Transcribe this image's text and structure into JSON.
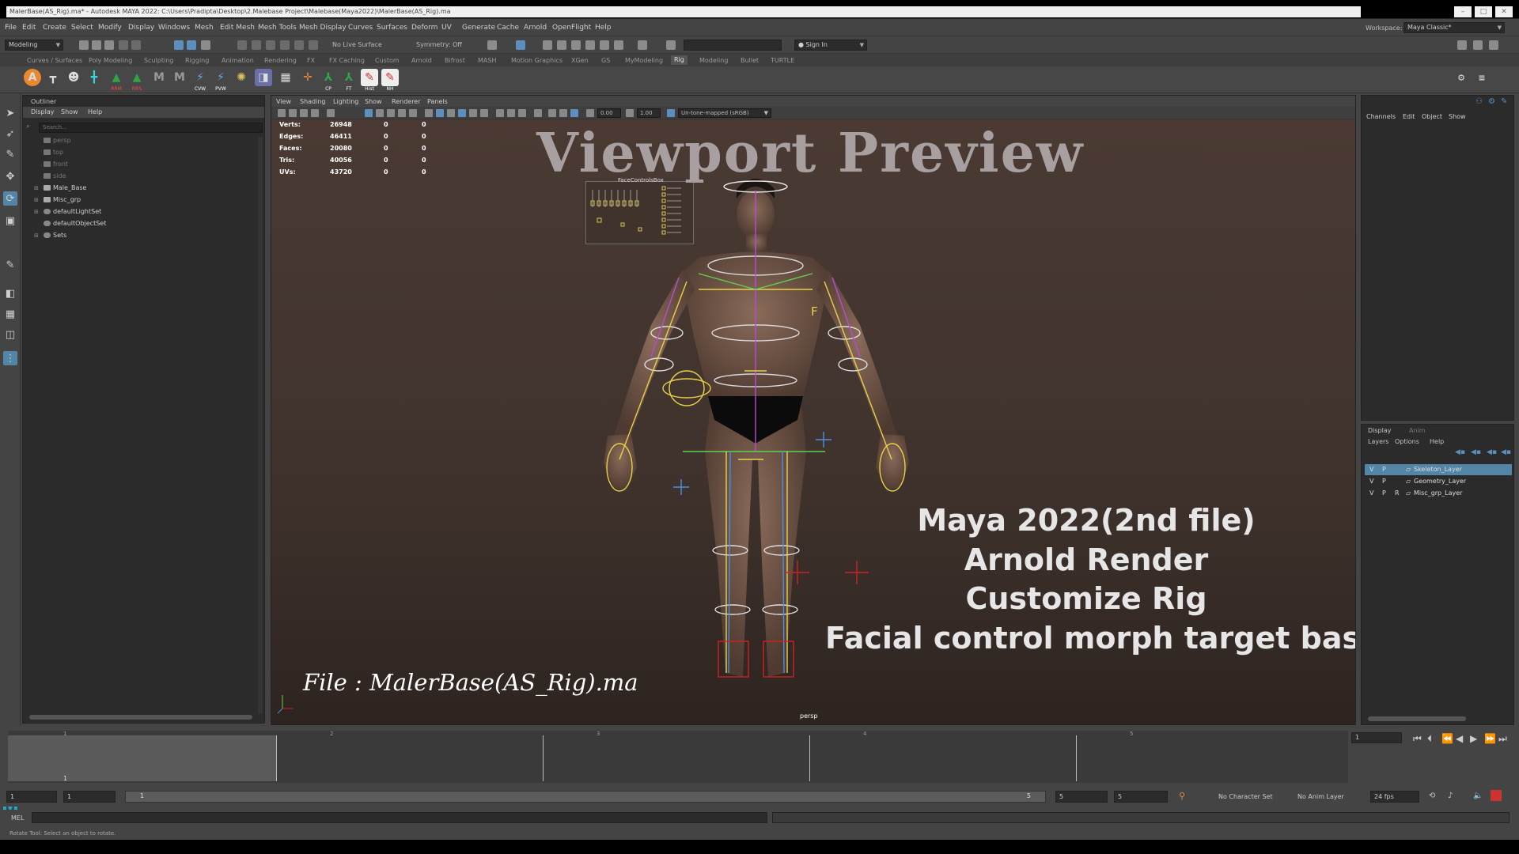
{
  "window": {
    "title": "MalerBase(AS_Rig).ma* - Autodesk MAYA 2022: C:\\Users\\Pradipta\\Desktop\\2.Malebase Project\\Malebase(Maya2022)\\MalerBase(AS_Rig).ma",
    "min": "–",
    "max": "□",
    "close": "✕"
  },
  "menubar": {
    "items": [
      "File",
      "Edit",
      "Create",
      "Select",
      "Modify",
      "Display",
      "Windows",
      "Mesh",
      "Edit Mesh",
      "Mesh Tools",
      "Mesh Display",
      "Curves",
      "Surfaces",
      "Deform",
      "UV",
      "Generate",
      "Cache",
      "Arnold",
      "OpenFlight",
      "Help"
    ],
    "workspace_label": "Workspace:",
    "workspace_value": "Maya Classic*"
  },
  "statusline": {
    "mode": "Modeling",
    "live_surface": "No Live Surface",
    "symmetry": "Symmetry: Off",
    "sign_in": "Sign In"
  },
  "shelf": {
    "tabs": [
      "Curves / Surfaces",
      "Poly Modeling",
      "Sculpting",
      "Rigging",
      "Animation",
      "Rendering",
      "FX",
      "FX Caching",
      "Custom",
      "Arnold",
      "Bifrost",
      "MASH",
      "Motion Graphics",
      "XGen",
      "GS",
      "MyModeling",
      "Rig",
      "Modeling",
      "Bullet",
      "TURTLE"
    ],
    "active_tab": "Rig",
    "icon_labels": [
      "RRM",
      "RRS",
      "CVW",
      "PVW",
      "CP",
      "FT",
      "Hist",
      "NH"
    ]
  },
  "outliner": {
    "tab": "Outliner",
    "menu": [
      "Display",
      "Show",
      "Help"
    ],
    "search_placeholder": "Search...",
    "items": [
      "persp",
      "top",
      "front",
      "side",
      "Male_Base",
      "Misc_grp",
      "defaultLightSet",
      "defaultObjectSet",
      "Sets"
    ]
  },
  "viewport": {
    "menu": [
      "View",
      "Shading",
      "Lighting",
      "Show",
      "Renderer",
      "Panels"
    ],
    "field_a": "0.00",
    "field_b": "1.00",
    "colorspace": "Un-tone-mapped (sRGB)",
    "hud": [
      {
        "label": "Verts:",
        "a": "26948",
        "b": "0",
        "c": "0"
      },
      {
        "label": "Edges:",
        "a": "46411",
        "b": "0",
        "c": "0"
      },
      {
        "label": "Faces:",
        "a": "20080",
        "b": "0",
        "c": "0"
      },
      {
        "label": "Tris:",
        "a": "40056",
        "b": "0",
        "c": "0"
      },
      {
        "label": "UVs:",
        "a": "43720",
        "b": "0",
        "c": "0"
      }
    ],
    "title": "Viewport Preview",
    "overlay_lines": [
      "Maya 2022(2nd file)",
      "Arnold Render",
      "Customize Rig",
      "Facial control morph target base"
    ],
    "file_caption": "File : MalerBase(AS_Rig).ma",
    "camera": "persp",
    "face_control_label": "FaceControlsBox",
    "face_marker": "F"
  },
  "channelbox": {
    "menu": [
      "Channels",
      "Edit",
      "Object",
      "Show"
    ]
  },
  "layers": {
    "tabs": [
      "Display",
      "Anim"
    ],
    "menu": [
      "Layers",
      "Options",
      "Help"
    ],
    "rows": [
      {
        "v": "V",
        "p": "P",
        "r": "",
        "name": "Skeleton_Layer",
        "selected": true
      },
      {
        "v": "V",
        "p": "P",
        "r": "",
        "name": "Geometry_Layer",
        "selected": false
      },
      {
        "v": "V",
        "p": "P",
        "r": "R",
        "name": "Misc_grp_Layer",
        "selected": false
      }
    ]
  },
  "timeslider": {
    "ticks": [
      "1",
      "2",
      "3",
      "4",
      "5"
    ],
    "current_frame_label": "1",
    "current_frame": "1"
  },
  "range": {
    "start": "1",
    "anim_start": "1",
    "bar_start": "1",
    "bar_end": "5",
    "anim_end": "5",
    "end": "5",
    "character_set": "No Character Set",
    "anim_layer": "No Anim Layer",
    "fps": "24 fps"
  },
  "cmdline": {
    "label": "MEL"
  },
  "helpline": {
    "text": "Rotate Tool: Select an object to rotate."
  }
}
